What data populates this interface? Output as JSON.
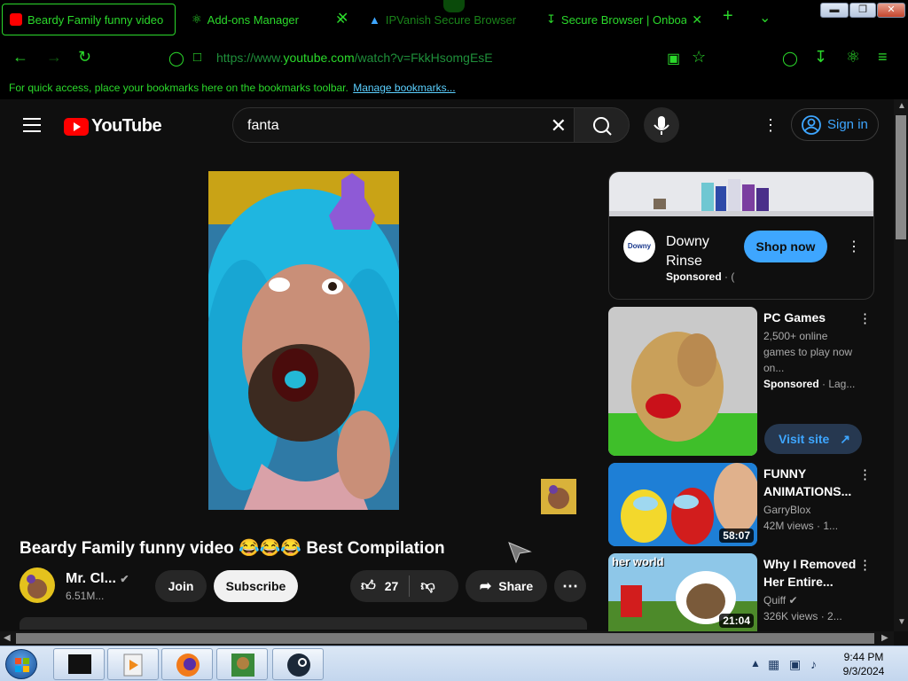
{
  "browser": {
    "tabs": [
      {
        "label": "Beardy Family funny video",
        "favicon_color": "#ff0000"
      },
      {
        "label": "Add-ons Manager"
      },
      {
        "label": "IPVanish Secure Browser"
      },
      {
        "label": "Secure Browser | Onboarding"
      }
    ],
    "new_tab_symbol": "+",
    "url_prefix": "https://www.",
    "url_domain": "youtube.com",
    "url_path": "/watch?v=FkkHsomgEsE",
    "bookmarks_text": "For quick access, place your bookmarks here on the bookmarks toolbar.",
    "bookmarks_link": "Manage bookmarks...",
    "accent": "#2bd92b"
  },
  "youtube": {
    "logo_text": "YouTube",
    "search_value": "fanta",
    "signin_label": "Sign in",
    "video": {
      "title": "Beardy Family funny video 😂😂😂 Best Compilation",
      "channel_name": "Mr. Cl...",
      "subscribers": "6.51M...",
      "join_label": "Join",
      "subscribe_label": "Subscribe",
      "likes": "27",
      "share_label": "Share"
    },
    "ad": {
      "brand": "Downy Rinse",
      "logo_text": "Downy",
      "sponsored": "Sponsored",
      "sponsored_suffix": " · (",
      "cta": "Shop now"
    },
    "recommendations": [
      {
        "title": "PC Games",
        "desc": "2,500+ online games to play now on...",
        "meta_bold": "Sponsored",
        "meta": " · Lag...",
        "cta": "Visit site"
      },
      {
        "title": "FUNNY ANIMATIONS...",
        "channel": "GarryBlox",
        "views": "42M views · 1...",
        "duration": "58:07"
      },
      {
        "title": "Why I Removed Her Entire...",
        "channel": "Quiff",
        "views": "326K views · 2...",
        "duration": "21:04",
        "thumb_caption": "her world"
      }
    ]
  },
  "taskbar": {
    "time": "9:44 PM",
    "date": "9/3/2024"
  }
}
